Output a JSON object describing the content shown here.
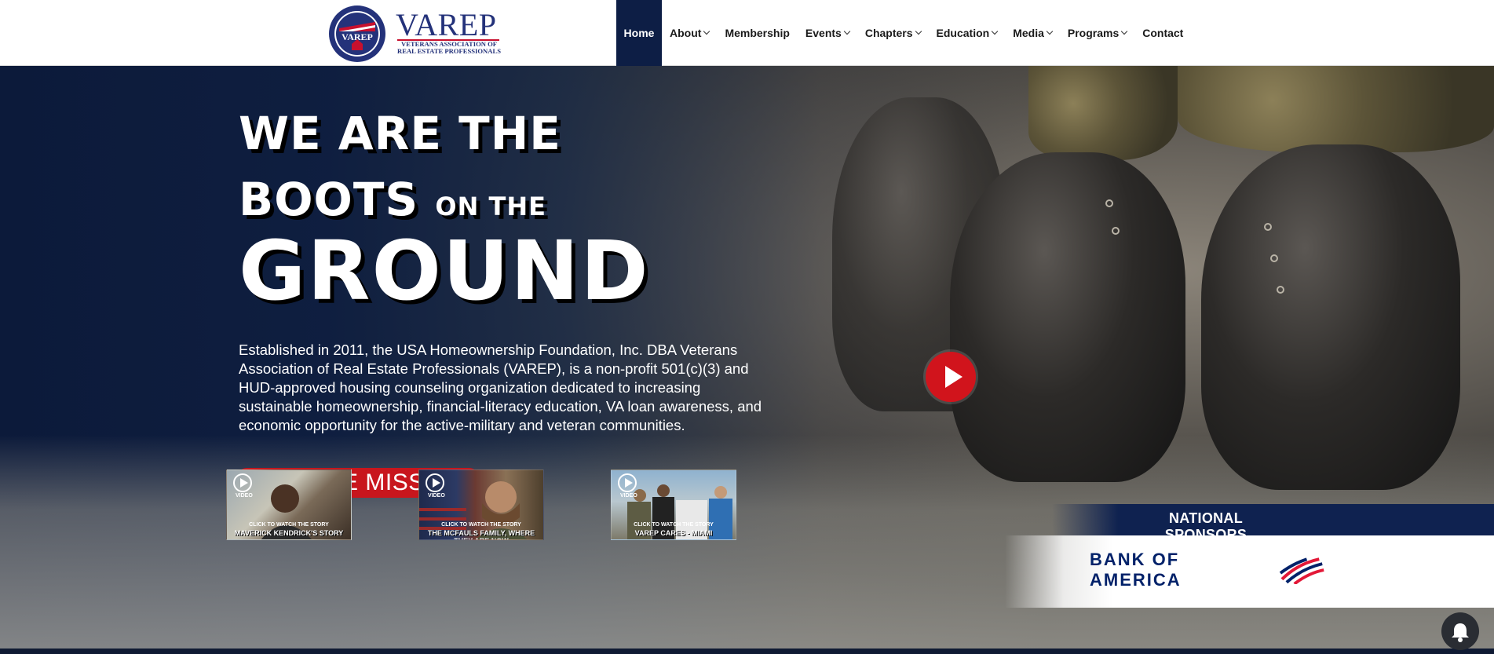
{
  "header": {
    "logo_text": "VAREP",
    "logo_seal_text": "VAREP",
    "logo_subtitle_1": "VETERANS ASSOCIATION OF",
    "logo_subtitle_2": "REAL ESTATE PROFESSIONALS",
    "nav": [
      {
        "label": "Home",
        "active": true,
        "dropdown": false
      },
      {
        "label": "About",
        "dropdown": true
      },
      {
        "label": "Membership",
        "dropdown": false
      },
      {
        "label": "Events",
        "dropdown": true
      },
      {
        "label": "Chapters",
        "dropdown": true
      },
      {
        "label": "Education",
        "dropdown": true
      },
      {
        "label": "Media",
        "dropdown": true
      },
      {
        "label": "Programs",
        "dropdown": true
      },
      {
        "label": "Contact",
        "dropdown": false
      }
    ]
  },
  "hero": {
    "line1": "WE ARE THE",
    "line2_big": "BOOTS",
    "line2_small": "ON THE",
    "line3": "GROUND",
    "description": "Established in 2011, the USA Homeownership Foundation, Inc. DBA Veterans Association of Real Estate Professionals (VAREP), is a non-profit 501(c)(3) and HUD-approved housing counseling organization dedicated to increasing sustainable homeownership, financial-literacy education, VA loan awareness, and economic opportunity for the active-military and veteran communities.",
    "cta_label": "JOIN THE MISSION"
  },
  "videos": [
    {
      "badge": "VIDEO",
      "caption1": "CLICK TO WATCH THE STORY",
      "caption2": "MAVERICK KENDRICK'S STORY"
    },
    {
      "badge": "VIDEO",
      "caption1": "CLICK TO WATCH THE STORY",
      "caption2": "THE MCFAULS FAMILY, WHERE THEY ARE NOW"
    },
    {
      "badge": "VIDEO",
      "caption1": "CLICK TO WATCH THE STORY",
      "caption2": "VAREP CARES - MIAMI"
    }
  ],
  "sponsors": {
    "title": "NATIONAL SPONSORS",
    "sponsor_name": "BANK OF AMERICA"
  },
  "colors": {
    "navy": "#0d1e45",
    "red": "#c8161d",
    "logo_blue": "#24327a"
  }
}
